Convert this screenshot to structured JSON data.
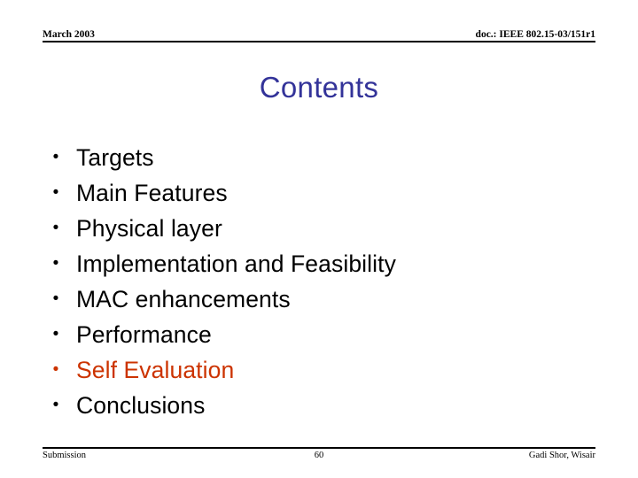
{
  "slide": {
    "header": {
      "left": "March 2003",
      "right": "doc.: IEEE 802.15-03/151r1"
    },
    "title": "Contents",
    "bullets": [
      {
        "label": "Targets",
        "marker": "•",
        "accent": false
      },
      {
        "label": "Main Features",
        "marker": "•",
        "accent": false
      },
      {
        "label": "Physical layer",
        "marker": "•",
        "accent": false
      },
      {
        "label": "Implementation and Feasibility",
        "marker": "•",
        "accent": false
      },
      {
        "label": "MAC enhancements",
        "marker": "•",
        "accent": false
      },
      {
        "label": "Performance",
        "marker": "•",
        "accent": false
      },
      {
        "label": "Self Evaluation",
        "marker": "•",
        "accent": true
      },
      {
        "label": "Conclusions",
        "marker": "•",
        "accent": false
      }
    ],
    "footer": {
      "left": "Submission",
      "page_number": "60",
      "right": "Gadi Shor, Wisair"
    },
    "colors": {
      "title": "#333399",
      "accent": "#cc3300",
      "text": "#000000",
      "background": "#ffffff",
      "rule": "#000000"
    }
  }
}
